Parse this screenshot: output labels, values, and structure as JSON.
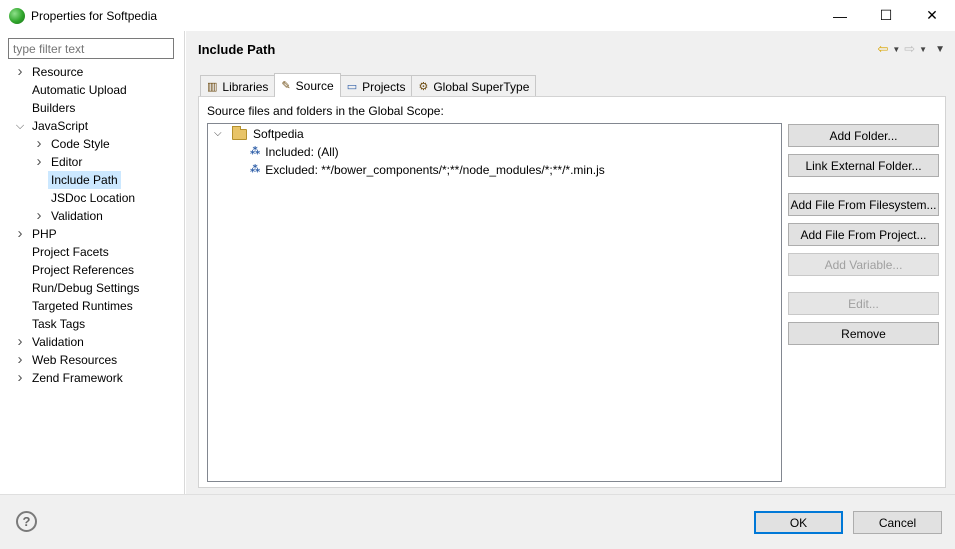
{
  "window": {
    "title": "Properties for Softpedia",
    "minimize_glyph": "—",
    "maximize_glyph": "☐",
    "close_glyph": "✕"
  },
  "sidebar": {
    "filter_placeholder": "type filter text",
    "items": [
      {
        "label": "Resource",
        "level": 0,
        "expander": "collapsed"
      },
      {
        "label": "Automatic Upload",
        "level": 0,
        "expander": "none"
      },
      {
        "label": "Builders",
        "level": 0,
        "expander": "none"
      },
      {
        "label": "JavaScript",
        "level": 0,
        "expander": "expanded"
      },
      {
        "label": "Code Style",
        "level": 1,
        "expander": "collapsed"
      },
      {
        "label": "Editor",
        "level": 1,
        "expander": "collapsed"
      },
      {
        "label": "Include Path",
        "level": 1,
        "expander": "none",
        "selected": true
      },
      {
        "label": "JSDoc Location",
        "level": 1,
        "expander": "none"
      },
      {
        "label": "Validation",
        "level": 1,
        "expander": "collapsed"
      },
      {
        "label": "PHP",
        "level": 0,
        "expander": "collapsed"
      },
      {
        "label": "Project Facets",
        "level": 0,
        "expander": "none"
      },
      {
        "label": "Project References",
        "level": 0,
        "expander": "none"
      },
      {
        "label": "Run/Debug Settings",
        "level": 0,
        "expander": "none"
      },
      {
        "label": "Targeted Runtimes",
        "level": 0,
        "expander": "none"
      },
      {
        "label": "Task Tags",
        "level": 0,
        "expander": "none"
      },
      {
        "label": "Validation",
        "level": 0,
        "expander": "collapsed"
      },
      {
        "label": "Web Resources",
        "level": 0,
        "expander": "collapsed"
      },
      {
        "label": "Zend Framework",
        "level": 0,
        "expander": "collapsed"
      }
    ]
  },
  "page": {
    "title": "Include Path",
    "nav": {
      "back_icon": "back-arrow-icon",
      "forward_icon": "forward-arrow-icon",
      "menu_icon": "view-menu-icon"
    }
  },
  "tabs": [
    {
      "label": "Libraries",
      "icon": "libraries-icon",
      "active": false
    },
    {
      "label": "Source",
      "icon": "source-icon",
      "active": true
    },
    {
      "label": "Projects",
      "icon": "projects-icon",
      "active": false
    },
    {
      "label": "Global SuperType",
      "icon": "supertype-icon",
      "active": false
    }
  ],
  "source": {
    "label": "Source files and folders in the Global Scope:",
    "root": "Softpedia",
    "children": [
      {
        "label": "Included: (All)",
        "icon": "included-filter-icon"
      },
      {
        "label": "Excluded: **/bower_components/*;**/node_modules/*;**/*.min.js",
        "icon": "excluded-filter-icon"
      }
    ]
  },
  "buttons": {
    "add_folder": "Add Folder...",
    "link_external": "Link External Folder...",
    "add_from_filesystem": "Add File From Filesystem...",
    "add_from_project": "Add File From Project...",
    "add_variable": "Add Variable...",
    "edit": "Edit...",
    "remove": "Remove"
  },
  "footer": {
    "help": "?",
    "ok": "OK",
    "cancel": "Cancel"
  },
  "colors": {
    "selection": "#cce8ff",
    "default_button_border": "#0078d7",
    "nav_arrow": "#d9a400"
  }
}
